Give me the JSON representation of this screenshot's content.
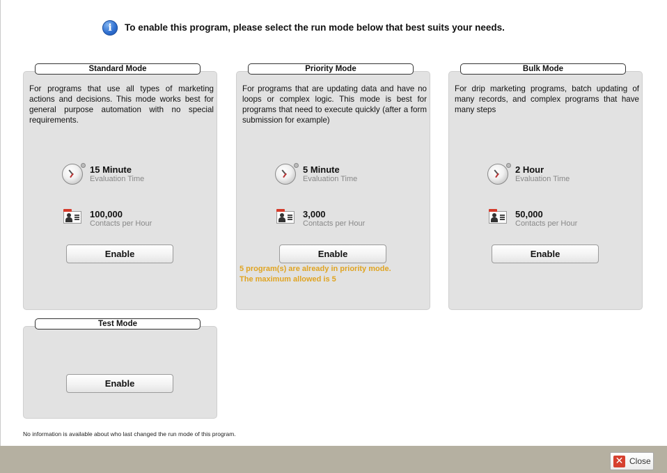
{
  "header": {
    "info_icon": "info-icon",
    "text": "To enable this program, please select the run mode below that best suits your needs."
  },
  "modes": [
    {
      "title": "Standard Mode",
      "description": "For programs that use all types of marketing actions and decisions. This mode works best for general purpose automation with no special requirements.",
      "evaluation_value": "15 Minute",
      "evaluation_label": "Evaluation Time",
      "contacts_value": "100,000",
      "contacts_label": "Contacts per Hour",
      "button_label": "Enable"
    },
    {
      "title": "Priority Mode",
      "description": "For programs that are updating data and have no loops or complex logic. This mode is best for programs that need to execute quickly (after a form submission for example)",
      "evaluation_value": "5 Minute",
      "evaluation_label": "Evaluation Time",
      "contacts_value": "3,000",
      "contacts_label": "Contacts per Hour",
      "button_label": "Enable",
      "warning_line1": "5 program(s) are already in priority mode.",
      "warning_line2": "The maximum allowed is 5",
      "warning_color": "#e0a421"
    },
    {
      "title": "Bulk Mode",
      "description": "For drip marketing programs, batch updating of many records, and complex programs that have many steps",
      "evaluation_value": "2 Hour",
      "evaluation_label": "Evaluation Time",
      "contacts_value": "50,000",
      "contacts_label": "Contacts per Hour",
      "button_label": "Enable"
    },
    {
      "title": "Test Mode",
      "button_label": "Enable"
    }
  ],
  "footer": {
    "note": "No information is available about who last changed the run mode of this program.",
    "close_label": "Close",
    "bar_color": "#b5b0a1"
  }
}
